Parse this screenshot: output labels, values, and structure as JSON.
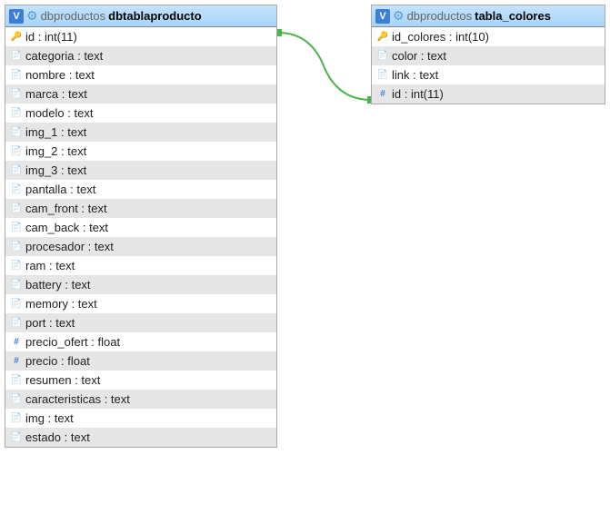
{
  "tables": {
    "t1": {
      "db": "dbproductos",
      "name": "dbtablaproducto",
      "columns": [
        {
          "icon": "key",
          "label": "id : int(11)"
        },
        {
          "icon": "doc",
          "label": "categoria : text"
        },
        {
          "icon": "doc",
          "label": "nombre : text"
        },
        {
          "icon": "doc",
          "label": "marca : text"
        },
        {
          "icon": "doc",
          "label": "modelo : text"
        },
        {
          "icon": "doc",
          "label": "img_1 : text"
        },
        {
          "icon": "doc",
          "label": "img_2 : text"
        },
        {
          "icon": "doc",
          "label": "img_3 : text"
        },
        {
          "icon": "doc",
          "label": "pantalla : text"
        },
        {
          "icon": "doc",
          "label": "cam_front : text"
        },
        {
          "icon": "doc",
          "label": "cam_back : text"
        },
        {
          "icon": "doc",
          "label": "procesador : text"
        },
        {
          "icon": "doc",
          "label": "ram : text"
        },
        {
          "icon": "doc",
          "label": "battery : text"
        },
        {
          "icon": "doc",
          "label": "memory : text"
        },
        {
          "icon": "doc",
          "label": "port : text"
        },
        {
          "icon": "hash",
          "label": "precio_ofert : float"
        },
        {
          "icon": "hash",
          "label": "precio : float"
        },
        {
          "icon": "doc",
          "label": "resumen : text"
        },
        {
          "icon": "doc",
          "label": "caracteristicas : text"
        },
        {
          "icon": "doc",
          "label": "img : text"
        },
        {
          "icon": "doc",
          "label": "estado : text"
        }
      ]
    },
    "t2": {
      "db": "dbproductos",
      "name": "tabla_colores",
      "columns": [
        {
          "icon": "key",
          "label": "id_colores : int(10)"
        },
        {
          "icon": "doc",
          "label": "color : text"
        },
        {
          "icon": "doc",
          "label": "link : text"
        },
        {
          "icon": "hash",
          "label": "id : int(11)"
        }
      ]
    }
  },
  "relation": {
    "from": "t1.id",
    "to": "t2.id"
  }
}
